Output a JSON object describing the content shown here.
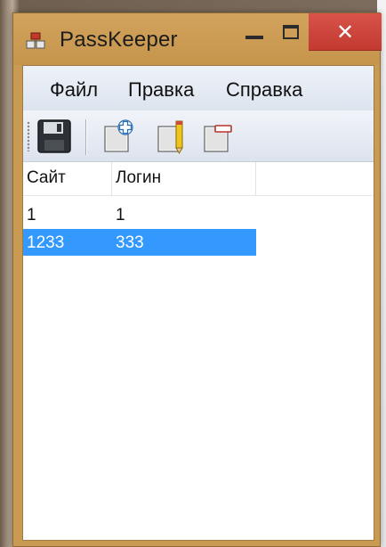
{
  "window": {
    "title": "PassKeeper",
    "close_symbol": "✕"
  },
  "menu": {
    "items": [
      {
        "label": "Файл"
      },
      {
        "label": "Правка"
      },
      {
        "label": "Справка"
      }
    ]
  },
  "toolbar": {
    "buttons": [
      {
        "icon": "save-icon"
      },
      {
        "icon": "add-icon"
      },
      {
        "icon": "edit-icon"
      },
      {
        "icon": "delete-icon"
      }
    ]
  },
  "table": {
    "columns": [
      "Сайт",
      "Логин"
    ],
    "rows": [
      {
        "site": "1",
        "login": "1",
        "selected": false
      },
      {
        "site": "1233",
        "login": "333",
        "selected": true
      }
    ]
  },
  "colors": {
    "titlebar": "#c99a52",
    "close_button": "#c23a30",
    "selection": "#3399ff"
  }
}
